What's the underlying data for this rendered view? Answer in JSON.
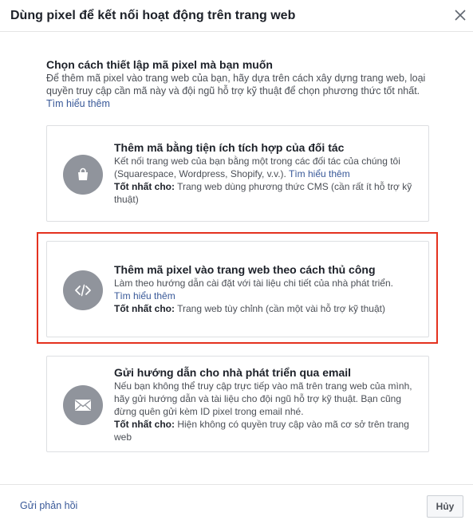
{
  "dialog": {
    "title": "Dùng pixel để kết nối hoạt động trên trang web"
  },
  "intro": {
    "heading": "Chọn cách thiết lập mã pixel mà bạn muốn",
    "description": "Để thêm mã pixel vào trang web của bạn, hãy dựa trên cách xây dựng trang web, loại quyền truy cập cần mã này và đội ngũ hỗ trợ kỹ thuật để chọn phương thức tốt nhất.",
    "learn_more": "Tìm hiểu thêm"
  },
  "options": [
    {
      "title": "Thêm mã bằng tiện ích tích hợp của đối tác",
      "description": "Kết nối trang web của bạn bằng một trong các đối tác của chúng tôi (Squarespace, Wordpress, Shopify, v.v.).",
      "learn_more": "Tìm hiểu thêm",
      "best_label": "Tốt nhất cho:",
      "best_value": "Trang web dùng phương thức CMS (cần rất ít hỗ trợ kỹ thuật)",
      "icon": "shopping-bag-icon"
    },
    {
      "title": "Thêm mã pixel vào trang web theo cách thủ công",
      "description": "Làm theo hướng dẫn cài đặt với tài liệu chi tiết của nhà phát triển.",
      "learn_more": "Tìm hiểu thêm",
      "best_label": "Tốt nhất cho:",
      "best_value": "Trang web tùy chỉnh (cần một vài hỗ trợ kỹ thuật)",
      "icon": "code-icon",
      "highlighted": true,
      "highlight_color": "#e4321f"
    },
    {
      "title": "Gửi hướng dẫn cho nhà phát triển qua email",
      "description": "Nếu bạn không thể truy cập trực tiếp vào mã trên trang web của mình, hãy gửi hướng dẫn và tài liệu cho đội ngũ hỗ trợ kỹ thuật. Bạn cũng đừng quên gửi kèm ID pixel trong email nhé.",
      "best_label": "Tốt nhất cho:",
      "best_value": "Hiện không có quyền truy cập vào mã cơ sở trên trang web",
      "icon": "envelope-icon"
    }
  ],
  "footer": {
    "feedback": "Gửi phản hồi",
    "cancel": "Hủy"
  },
  "colors": {
    "link": "#385898",
    "icon_circle": "#90949c",
    "highlight": "#e4321f"
  }
}
